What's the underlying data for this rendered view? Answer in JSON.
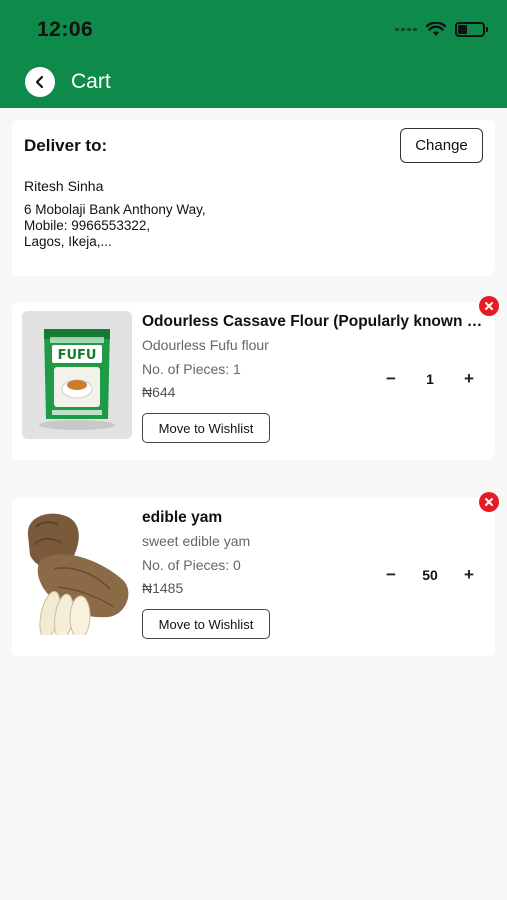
{
  "status_bar": {
    "time": "12:06"
  },
  "header": {
    "title": "Cart",
    "back_icon": "chevron-left-icon",
    "color": "#0e8a4a"
  },
  "address": {
    "label": "Deliver to:",
    "change_label": "Change",
    "name": "Ritesh Sinha",
    "lines": [
      "6 Mobolaji Bank Anthony Way,",
      "Mobile: 9966553322,",
      "Lagos, Ikeja,..."
    ]
  },
  "items": [
    {
      "name": "Odourless Cassave Flour (Popularly known as Fufu)",
      "description": "Odourless Fufu flour",
      "pieces": "No. of Pieces: 1",
      "price": "₦644",
      "quantity": "1",
      "wishlist_label": "Move to Wishlist",
      "image": "fufu-flour-package-image",
      "package_text": "FUFU"
    },
    {
      "name": "edible yam",
      "description": "sweet edible yam",
      "pieces": "No. of Pieces: 0",
      "price": "₦1485",
      "quantity": "50",
      "wishlist_label": "Move to Wishlist",
      "image": "yam-image"
    }
  ],
  "qty_controls": {
    "minus": "−",
    "plus": "+"
  },
  "colors": {
    "accent": "#0e8a4a",
    "remove": "#e61c24"
  }
}
